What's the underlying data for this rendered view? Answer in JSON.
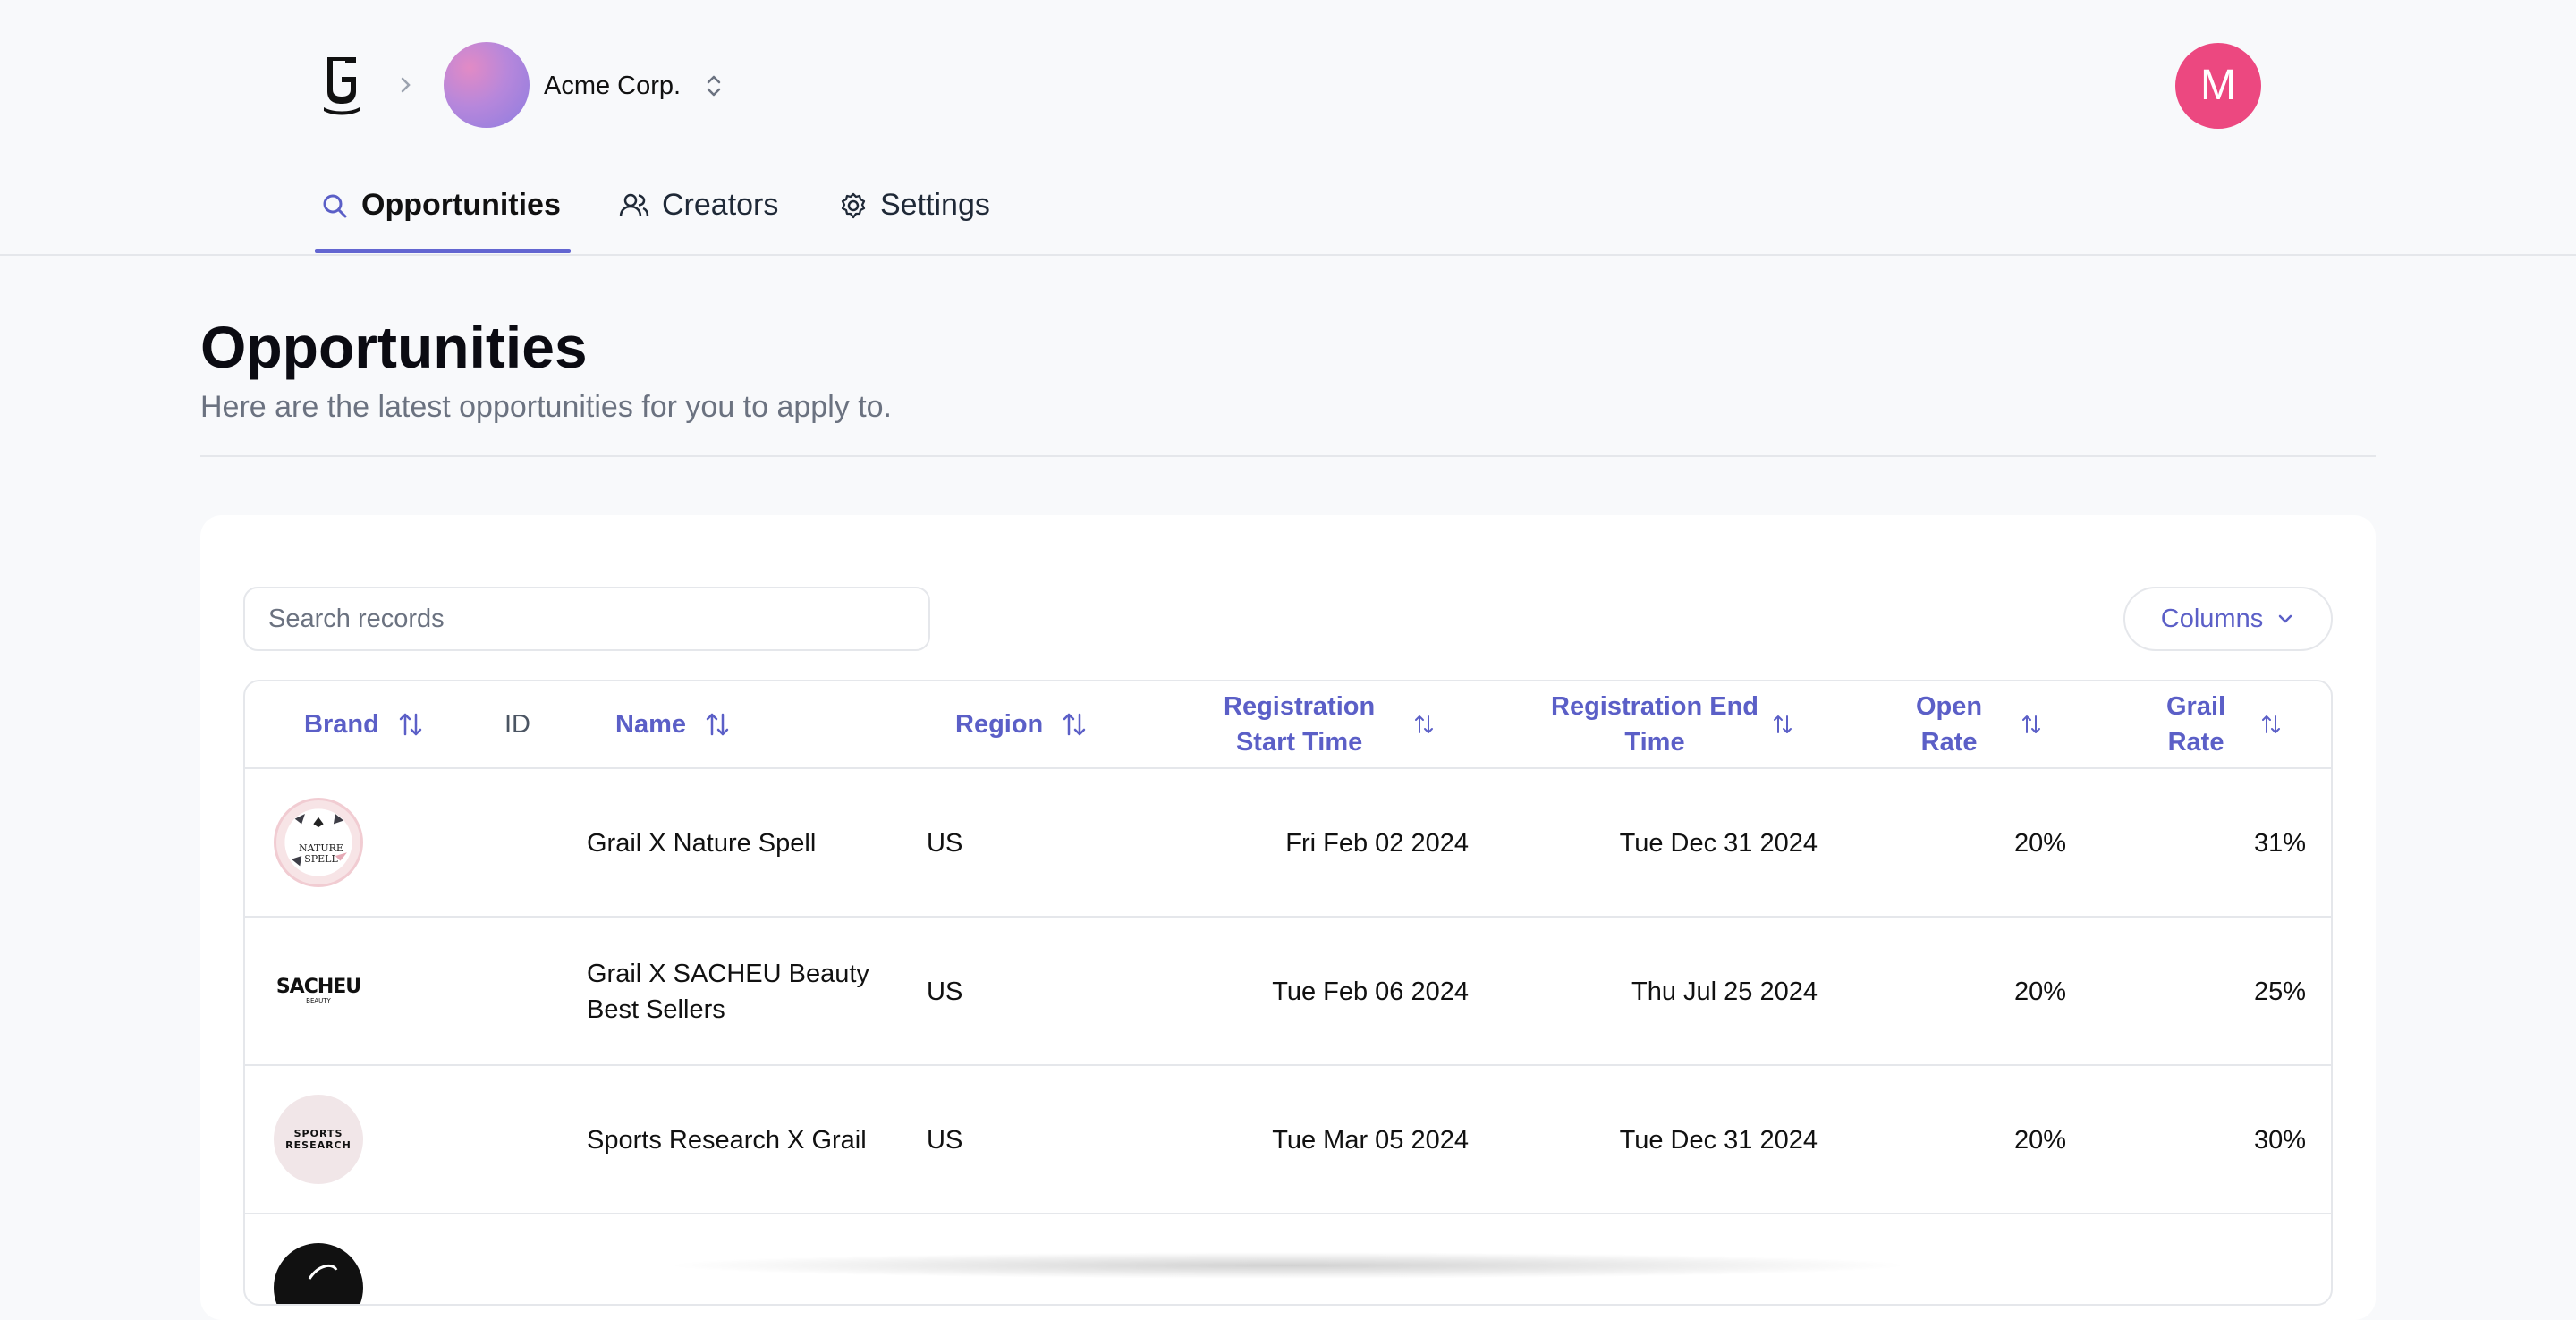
{
  "org": {
    "name": "Acme Corp."
  },
  "user": {
    "initial": "M"
  },
  "tabs": [
    {
      "label": "Opportunities",
      "icon": "search-icon",
      "active": true
    },
    {
      "label": "Creators",
      "icon": "users-icon",
      "active": false
    },
    {
      "label": "Settings",
      "icon": "gear-icon",
      "active": false
    }
  ],
  "page": {
    "title": "Opportunities",
    "subtitle": "Here are the latest opportunities for you to apply to."
  },
  "toolbar": {
    "search_placeholder": "Search records",
    "search_value": "",
    "columns_label": "Columns"
  },
  "table": {
    "headers": {
      "brand": "Brand",
      "id": "ID",
      "name": "Name",
      "region": "Region",
      "reg_start_1": "Registration",
      "reg_start_2": "Start Time",
      "reg_end_1": "Registration End",
      "reg_end_2": "Time",
      "open_1": "Open",
      "open_2": "Rate",
      "grail_1": "Grail",
      "grail_2": "Rate"
    },
    "rows": [
      {
        "logo_text_1": "NATURE",
        "logo_text_2": "SPELL",
        "id": "",
        "name_1": "Grail X Nature Spell",
        "name_2": "",
        "region": "US",
        "start": "Fri Feb 02 2024",
        "end": "Tue Dec 31 2024",
        "open_rate": "20%",
        "grail_rate": "31%"
      },
      {
        "logo_text_1": "SACHEU",
        "logo_text_2": "BEAUTY",
        "id": "",
        "name_1": "Grail X SACHEU Beauty",
        "name_2": "Best Sellers",
        "region": "US",
        "start": "Tue Feb 06 2024",
        "end": "Thu Jul 25 2024",
        "open_rate": "20%",
        "grail_rate": "25%"
      },
      {
        "logo_text_1": "SPORTS",
        "logo_text_2": "RESEARCH",
        "id": "",
        "name_1": "Sports Research X Grail",
        "name_2": "",
        "region": "US",
        "start": "Tue Mar 05 2024",
        "end": "Tue Dec 31 2024",
        "open_rate": "20%",
        "grail_rate": "30%"
      }
    ]
  },
  "colors": {
    "accent": "#5b5fc7",
    "avatar": "#ec4880",
    "background": "#f8f9fb"
  }
}
